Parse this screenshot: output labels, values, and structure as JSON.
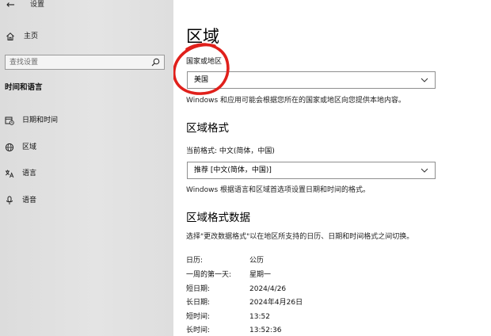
{
  "app": {
    "title": "设置",
    "back_icon": "back-arrow-icon"
  },
  "sidebar": {
    "home_label": "主页",
    "home_icon": "home-icon",
    "search_placeholder": "查找设置",
    "section_title": "时间和语言",
    "items": [
      {
        "label": "日期和时间",
        "icon": "calendar-clock-icon"
      },
      {
        "label": "区域",
        "icon": "globe-icon"
      },
      {
        "label": "语言",
        "icon": "language-icon"
      },
      {
        "label": "语音",
        "icon": "microphone-icon"
      }
    ]
  },
  "main": {
    "title": "区域",
    "country": {
      "label": "国家或地区",
      "value": "美国",
      "description": "Windows 和应用可能会根据您所在的国家或地区向您提供本地内容。"
    },
    "format": {
      "heading": "区域格式",
      "current_label": "当前格式: 中文(简体，中国)",
      "value": "推荐 [中文(简体，中国)]",
      "description": "Windows 根据语言和区域首选项设置日期和时间的格式。"
    },
    "format_data": {
      "heading": "区域格式数据",
      "description": "选择\"更改数据格式\"以在地区所支持的日历、日期和时间格式之间切换。",
      "rows": [
        {
          "label": "日历:",
          "value": "公历"
        },
        {
          "label": "一周的第一天:",
          "value": "星期一"
        },
        {
          "label": "短日期:",
          "value": "2024/4/26"
        },
        {
          "label": "长日期:",
          "value": "2024年4月26日"
        },
        {
          "label": "短时间:",
          "value": "13:52"
        },
        {
          "label": "长时间:",
          "value": "13:52:36"
        }
      ]
    }
  },
  "colors": {
    "annotation_red": "#e0201b",
    "sidebar_bg": "#e2e2e2"
  }
}
